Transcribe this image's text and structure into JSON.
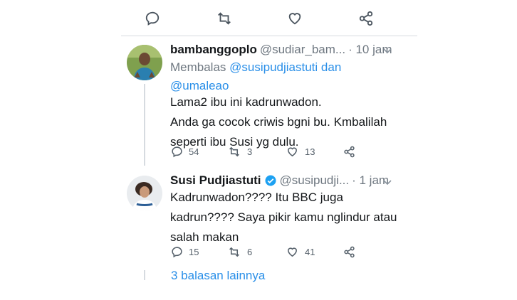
{
  "tweet1": {
    "name": "bambanggoplo",
    "handle": "@sudiar_bam...",
    "time": "· 10 jam",
    "reply_prefix": "Membalas ",
    "reply_to_1": "@susipudjiastuti",
    "reply_and": " dan",
    "reply_to_2": "@umaleao",
    "text_line1": "Lama2 ibu ini kadrunwadon.",
    "text_line2": "Anda ga cocok criwis bgni bu. Kmbalilah",
    "text_line3": "seperti ibu Susi yg dulu.",
    "replies": "54",
    "retweets": "3",
    "likes": "13"
  },
  "tweet2": {
    "name": "Susi Pudjiastuti",
    "handle": "@susipudji...",
    "time": "· 1 jam",
    "text_line1": "Kadrunwadon???? Itu BBC juga",
    "text_line2": "kadrun???? Saya pikir kamu nglindur atau",
    "text_line3": "salah makan",
    "replies": "15",
    "retweets": "6",
    "likes": "41"
  },
  "more_replies": "3 balasan lainnya",
  "colors": {
    "link": "#2a8fe8",
    "verified": "#1da1f2",
    "muted": "#6e7780"
  }
}
